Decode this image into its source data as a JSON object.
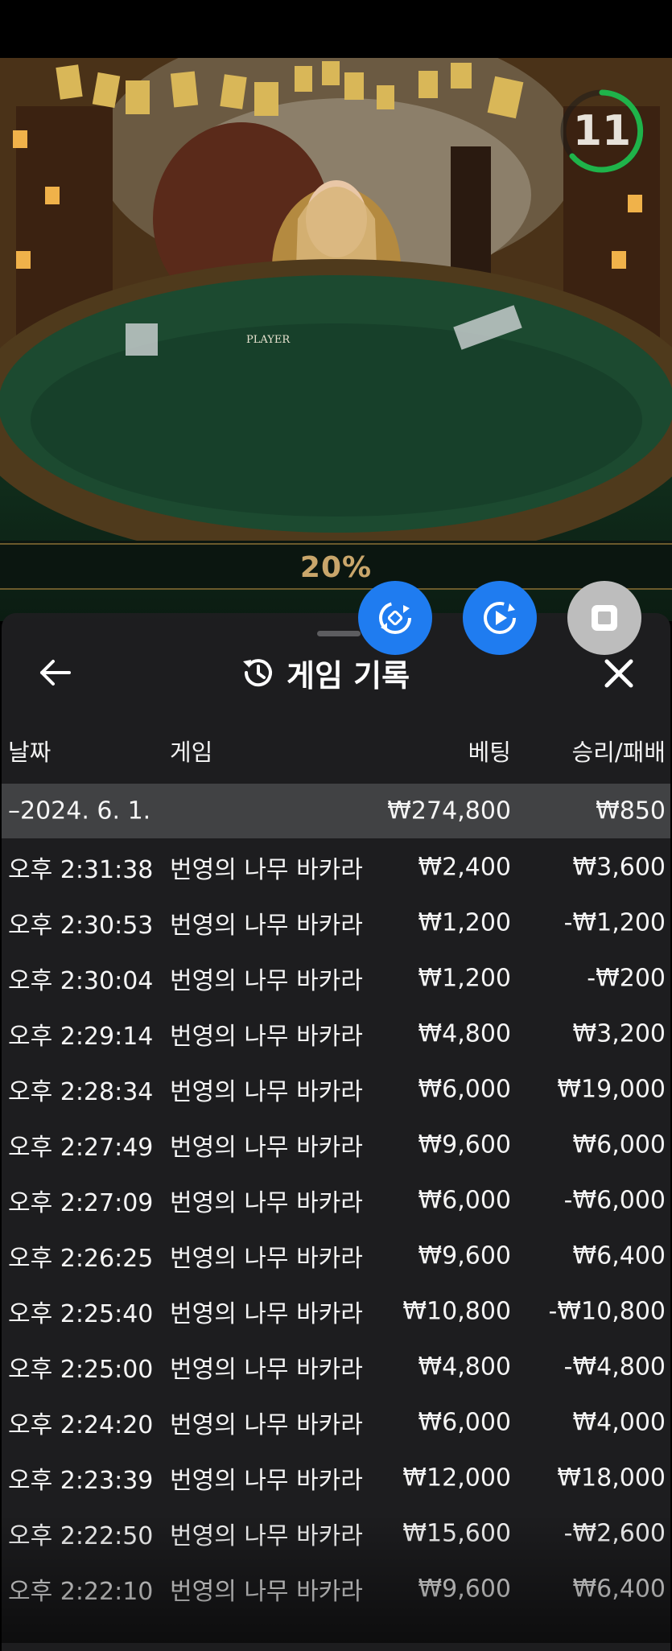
{
  "video": {
    "timer": "11",
    "table_label": "PLAYER",
    "percent": "20%"
  },
  "colors": {
    "accent_blue": "#1f7cf0",
    "timer_green": "#1fb34a",
    "panel_bg": "#1e1e20",
    "summary_bg": "#414244"
  },
  "controls": {
    "icons": [
      "swap-icon",
      "replay-icon",
      "stop-icon"
    ]
  },
  "panel": {
    "title": "게임 기록",
    "back_icon": "arrow-left-icon",
    "history_icon": "history-icon",
    "close_icon": "close-icon",
    "columns": {
      "date": "날짜",
      "game": "게임",
      "bet": "베팅",
      "result": "승리/패배"
    },
    "summary": {
      "date": "–2024. 6. 1.",
      "bet": "₩274,800",
      "result": "₩850"
    },
    "rows": [
      {
        "time": "오후 2:31:38",
        "game": "번영의 나무 바카라",
        "bet": "₩2,400",
        "result": "₩3,600"
      },
      {
        "time": "오후 2:30:53",
        "game": "번영의 나무 바카라",
        "bet": "₩1,200",
        "result": "-₩1,200"
      },
      {
        "time": "오후 2:30:04",
        "game": "번영의 나무 바카라",
        "bet": "₩1,200",
        "result": "-₩200"
      },
      {
        "time": "오후 2:29:14",
        "game": "번영의 나무 바카라",
        "bet": "₩4,800",
        "result": "₩3,200"
      },
      {
        "time": "오후 2:28:34",
        "game": "번영의 나무 바카라",
        "bet": "₩6,000",
        "result": "₩19,000"
      },
      {
        "time": "오후 2:27:49",
        "game": "번영의 나무 바카라",
        "bet": "₩9,600",
        "result": "₩6,000"
      },
      {
        "time": "오후 2:27:09",
        "game": "번영의 나무 바카라",
        "bet": "₩6,000",
        "result": "-₩6,000"
      },
      {
        "time": "오후 2:26:25",
        "game": "번영의 나무 바카라",
        "bet": "₩9,600",
        "result": "₩6,400"
      },
      {
        "time": "오후 2:25:40",
        "game": "번영의 나무 바카라",
        "bet": "₩10,800",
        "result": "-₩10,800"
      },
      {
        "time": "오후 2:25:00",
        "game": "번영의 나무 바카라",
        "bet": "₩4,800",
        "result": "-₩4,800"
      },
      {
        "time": "오후 2:24:20",
        "game": "번영의 나무 바카라",
        "bet": "₩6,000",
        "result": "₩4,000"
      },
      {
        "time": "오후 2:23:39",
        "game": "번영의 나무 바카라",
        "bet": "₩12,000",
        "result": "₩18,000"
      },
      {
        "time": "오후 2:22:50",
        "game": "번영의 나무 바카라",
        "bet": "₩15,600",
        "result": "-₩2,600"
      },
      {
        "time": "오후 2:22:10",
        "game": "번영의 나무 바카라",
        "bet": "₩9,600",
        "result": "₩6,400"
      }
    ]
  }
}
